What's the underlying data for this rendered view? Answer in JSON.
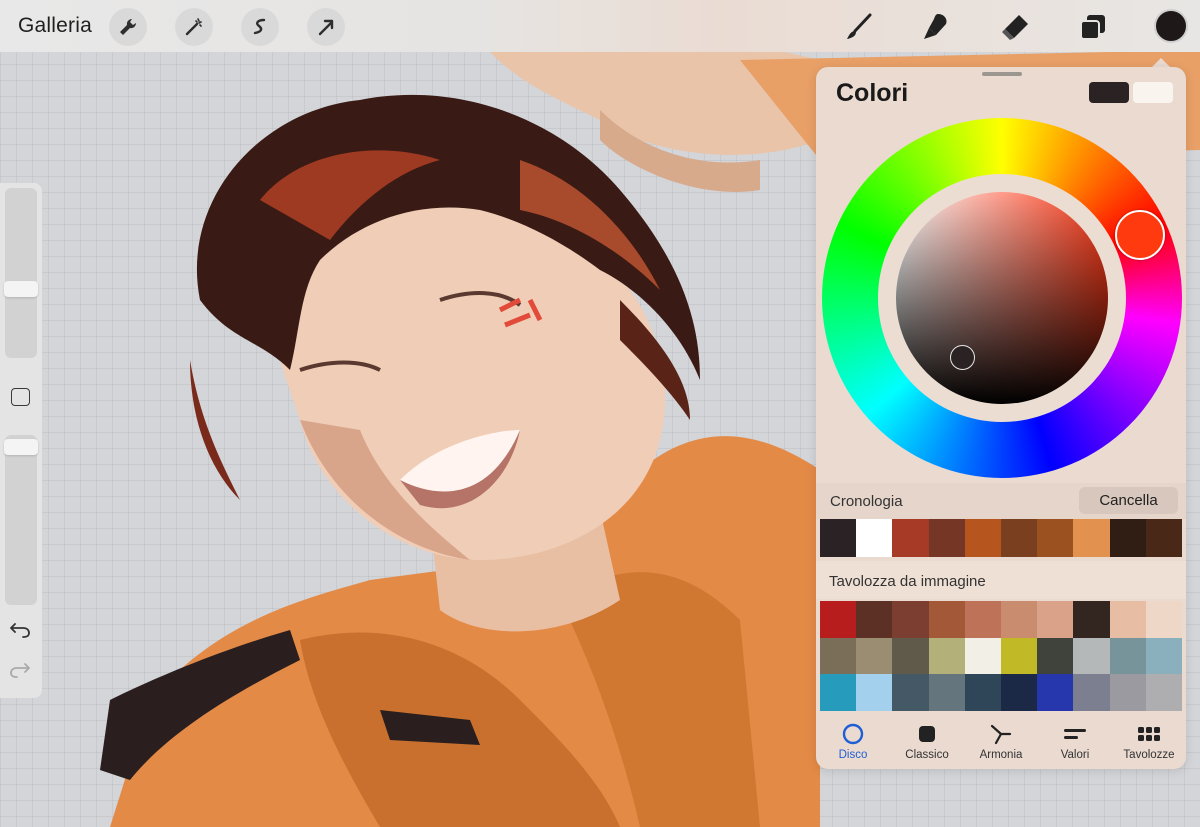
{
  "topbar": {
    "gallery_label": "Galleria",
    "left_tools": [
      "wrench-icon",
      "magic-wand-icon",
      "selection-icon",
      "transform-arrow-icon"
    ],
    "right_tools": [
      "brush-icon",
      "smudge-icon",
      "eraser-icon",
      "layers-icon"
    ],
    "current_color": "#1f1818"
  },
  "sidebar": {
    "undo_icon": "undo-icon",
    "redo_icon": "redo-icon"
  },
  "colors_panel": {
    "title": "Colori",
    "primary_color": "#2b2223",
    "secondary_color": "#faf4ee",
    "selected_hue": "#ff3a0e",
    "history": {
      "label": "Cronologia",
      "clear_label": "Cancella",
      "swatches": [
        "#2a2224",
        "#ffffff",
        "#a63a26",
        "#763626",
        "#b6561e",
        "#7a3f1e",
        "#9c5121",
        "#e2914f",
        "#301d13",
        "#4a2817"
      ]
    },
    "palette": {
      "label": "Tavolozza da immagine",
      "swatches": [
        "#b81d1d",
        "#5c3024",
        "#7c3e30",
        "#a35838",
        "#be7358",
        "#c98c6e",
        "#dba28a",
        "#332620",
        "#e7bda4",
        "#eed7c7",
        "#7a6e58",
        "#9a8d72",
        "#605a4a",
        "#b4b07a",
        "#f1efe6",
        "#c1ba26",
        "#3f433c",
        "#b5b8b8",
        "#76949a",
        "#89b0bc",
        "#279bbc",
        "#a3d1ed",
        "#445866",
        "#64757e",
        "#2e4658",
        "#1b2947",
        "#2637ae",
        "#7c7f8f",
        "#9a9aa0",
        "#aeadaf"
      ]
    },
    "tabs": [
      {
        "label": "Disco",
        "icon": "disc-icon",
        "active": true
      },
      {
        "label": "Classico",
        "icon": "classic-square-icon",
        "active": false
      },
      {
        "label": "Armonia",
        "icon": "harmony-icon",
        "active": false
      },
      {
        "label": "Valori",
        "icon": "values-sliders-icon",
        "active": false
      },
      {
        "label": "Tavolozze",
        "icon": "palettes-grid-icon",
        "active": false
      }
    ]
  }
}
